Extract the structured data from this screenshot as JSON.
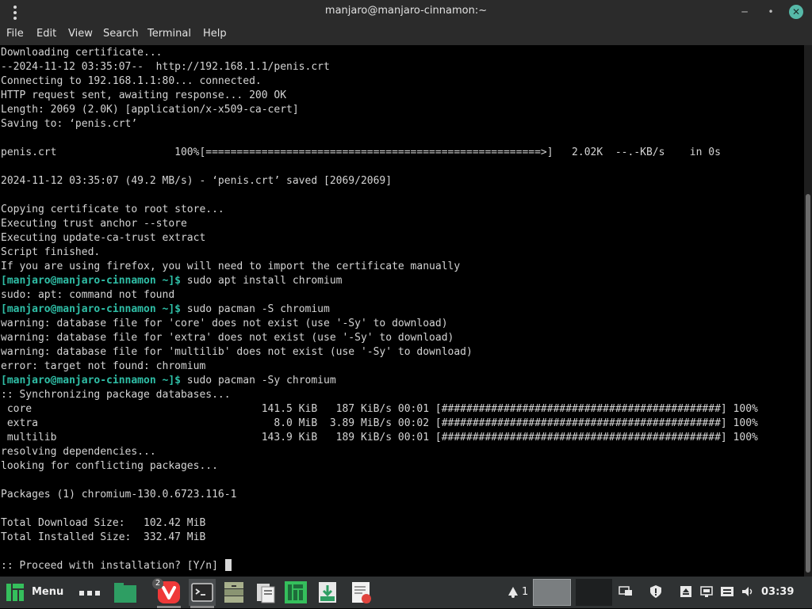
{
  "window": {
    "title": "manjaro@manjaro-cinnamon:~",
    "menu": [
      "File",
      "Edit",
      "View",
      "Search",
      "Terminal",
      "Help"
    ]
  },
  "terminal": {
    "lines": [
      {
        "text": "Downloading certificate..."
      },
      {
        "text": "--2024-11-12 03:35:07--  http://192.168.1.1/penis.crt"
      },
      {
        "text": "Connecting to 192.168.1.1:80... connected."
      },
      {
        "text": "HTTP request sent, awaiting response... 200 OK"
      },
      {
        "text": "Length: 2069 (2.0K) [application/x-x509-ca-cert]"
      },
      {
        "text": "Saving to: ‘penis.crt’"
      },
      {
        "text": ""
      },
      {
        "text": "penis.crt                   100%[======================================================>]   2.02K  --.-KB/s    in 0s"
      },
      {
        "text": ""
      },
      {
        "text": "2024-11-12 03:35:07 (49.2 MB/s) - ‘penis.crt’ saved [2069/2069]"
      },
      {
        "text": ""
      },
      {
        "text": "Copying certificate to root store..."
      },
      {
        "text": "Executing trust anchor --store"
      },
      {
        "text": "Executing update-ca-trust extract"
      },
      {
        "text": "Script finished."
      },
      {
        "text": "If you are using firefox, you will need to import the certificate manually"
      },
      {
        "prompt": "[manjaro@manjaro-cinnamon ~]$",
        "text": " sudo apt install chromium"
      },
      {
        "text": "sudo: apt: command not found"
      },
      {
        "prompt": "[manjaro@manjaro-cinnamon ~]$",
        "text": " sudo pacman -S chromium"
      },
      {
        "text": "warning: database file for 'core' does not exist (use '-Sy' to download)"
      },
      {
        "text": "warning: database file for 'extra' does not exist (use '-Sy' to download)"
      },
      {
        "text": "warning: database file for 'multilib' does not exist (use '-Sy' to download)"
      },
      {
        "text": "error: target not found: chromium"
      },
      {
        "prompt": "[manjaro@manjaro-cinnamon ~]$",
        "text": " sudo pacman -Sy chromium"
      },
      {
        "text": ":: Synchronizing package databases..."
      },
      {
        "text": " core                                     141.5 KiB   187 KiB/s 00:01 [#############################################] 100%"
      },
      {
        "text": " extra                                      8.0 MiB  3.89 MiB/s 00:02 [#############################################] 100%"
      },
      {
        "text": " multilib                                 143.9 KiB   189 KiB/s 00:01 [#############################################] 100%"
      },
      {
        "text": "resolving dependencies..."
      },
      {
        "text": "looking for conflicting packages..."
      },
      {
        "text": ""
      },
      {
        "text": "Packages (1) chromium-130.0.6723.116-1"
      },
      {
        "text": ""
      },
      {
        "text": "Total Download Size:   102.42 MiB"
      },
      {
        "text": "Total Installed Size:  332.47 MiB"
      },
      {
        "text": ""
      },
      {
        "text": ":: Proceed with installation? [Y/n] ",
        "cursor": true
      }
    ]
  },
  "taskbar": {
    "menu_label": "Menu",
    "apps": [
      {
        "name": "vivaldi",
        "badge": "2"
      },
      {
        "name": "terminal"
      },
      {
        "name": "archive-manager"
      },
      {
        "name": "clipboard"
      },
      {
        "name": "manjaro-settings"
      },
      {
        "name": "package-installer"
      },
      {
        "name": "text-editor"
      }
    ],
    "notification_count": "1",
    "clock": "03:39"
  },
  "colors": {
    "prompt": "#2fbfa7",
    "accent": "#35bf5c",
    "close_button": "#56b9a8"
  }
}
